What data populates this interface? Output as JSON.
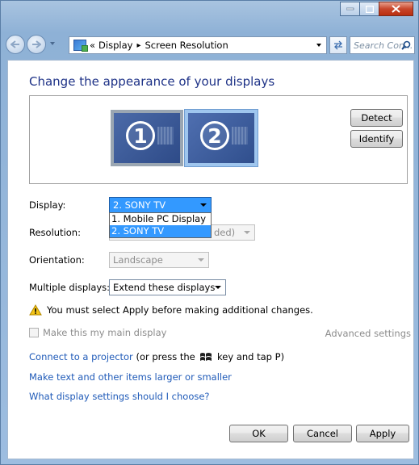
{
  "address": {
    "breadcrumb_sep": "«",
    "crumb1": "Display",
    "arrow": "▸",
    "crumb2": "Screen Resolution",
    "search_placeholder": "Search Con..."
  },
  "page": {
    "title": "Change the appearance of your displays"
  },
  "preview": {
    "monitor1": "1",
    "monitor2": "2",
    "detect_label": "Detect",
    "identify_label": "Identify"
  },
  "fields": {
    "display_label": "Display:",
    "display_value": "2. SONY TV",
    "display_options": [
      "1. Mobile PC Display",
      "2. SONY TV"
    ],
    "resolution_label": "Resolution:",
    "resolution_value_partial": "ded)",
    "orientation_label": "Orientation:",
    "orientation_value": "Landscape",
    "multiple_label": "Multiple displays:",
    "multiple_value": "Extend these displays"
  },
  "warning": "You must select Apply before making additional changes.",
  "main_display_label": "Make this my main display",
  "advanced_settings": "Advanced settings",
  "links": {
    "projector": "Connect to a projector",
    "projector_rest": "(or press the",
    "projector_key_tail": "key and tap P)",
    "text_size": "Make text and other items larger or smaller",
    "choose": "What display settings should I choose?"
  },
  "buttons": {
    "ok": "OK",
    "cancel": "Cancel",
    "apply": "Apply"
  },
  "colors": {
    "title": "#1e3287",
    "link": "#1f5ab8",
    "highlight": "#3399ff"
  }
}
